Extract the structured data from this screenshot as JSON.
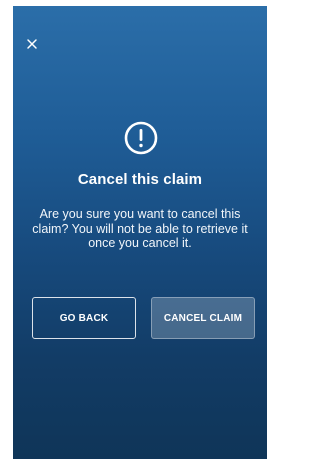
{
  "dialog": {
    "close_icon": "close-icon",
    "alert_icon": "exclamation-circle-icon",
    "title": "Cancel this claim",
    "message": "Are you sure you want to cancel this claim? You will not be able to retrieve it once you cancel it.",
    "go_back_label": "GO BACK",
    "cancel_claim_label": "CANCEL CLAIM"
  },
  "colors": {
    "background_top": "#2b6ea9",
    "background_bottom": "#0f3558",
    "text": "#ffffff"
  }
}
